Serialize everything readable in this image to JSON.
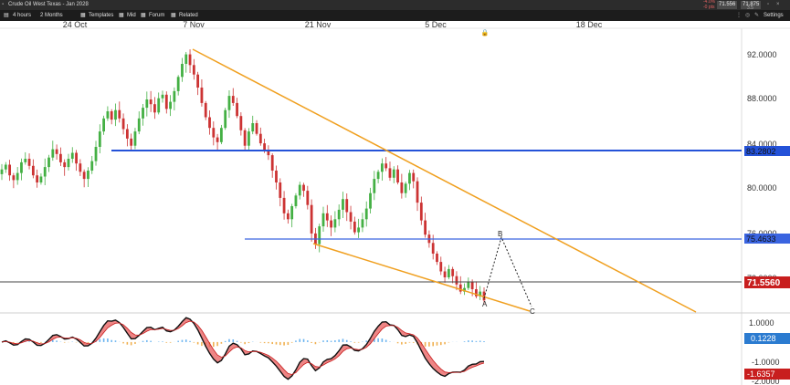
{
  "window": {
    "title": "Crude Oil West Texas - Jan 2023",
    "change_pct": "-4.0%",
    "change_pts": "-0 pts",
    "sell_price": "71.556",
    "buy_price": "71.875",
    "spread": "3.5"
  },
  "toolbar": {
    "interval": "4 hours",
    "range": "2 Months",
    "templates": "Templates",
    "price_type": "Mid",
    "forum": "Forum",
    "related": "Related",
    "settings": "Settings"
  },
  "chart_data": [
    {
      "type": "candlestick",
      "title": "",
      "x_ticks": [
        "24 Oct",
        "7 Nov",
        "21 Nov",
        "5 Dec",
        "18 Dec"
      ],
      "y_ticks": [
        "92.0000",
        "88.0000",
        "84.0000",
        "80.0000",
        "76.0000",
        "72.0000"
      ],
      "ylim": [
        70.5,
        94.5
      ],
      "grid": false,
      "close_series": [
        82.6,
        83.0,
        82.1,
        81.7,
        82.3,
        83.2,
        83.5,
        82.9,
        82.1,
        81.5,
        82.0,
        82.8,
        83.6,
        84.3,
        83.9,
        83.2,
        82.8,
        83.5,
        84.0,
        83.1,
        82.4,
        81.8,
        82.5,
        83.3,
        84.5,
        85.8,
        86.9,
        87.5,
        86.8,
        87.6,
        86.9,
        86.0,
        85.2,
        84.6,
        85.8,
        86.9,
        87.8,
        88.5,
        88.1,
        87.4,
        88.6,
        88.9,
        87.7,
        88.3,
        89.2,
        90.4,
        91.5,
        92.3,
        91.4,
        90.6,
        89.5,
        88.2,
        87.0,
        86.1,
        85.3,
        84.9,
        86.1,
        87.6,
        88.8,
        88.2,
        87.1,
        85.9,
        84.6,
        85.8,
        86.5,
        85.6,
        84.8,
        84.2,
        83.8,
        82.5,
        81.5,
        80.2,
        78.9,
        78.4,
        79.5,
        80.4,
        81.3,
        80.8,
        79.6,
        77.2,
        76.3,
        77.8,
        78.9,
        78.3,
        77.7,
        78.4,
        79.2,
        80.1,
        79.0,
        78.2,
        77.3,
        77.7,
        78.4,
        79.3,
        80.6,
        81.8,
        82.4,
        83.1,
        82.7,
        81.9,
        82.6,
        81.5,
        80.6,
        81.4,
        82.3,
        81.6,
        79.8,
        78.3,
        77.1,
        76.4,
        75.5,
        74.8,
        74.0,
        73.5,
        74.2,
        73.6,
        72.9,
        72.3,
        72.6,
        73.1,
        72.5,
        71.9,
        72.3,
        71.556
      ],
      "overlays": {
        "horizontal_levels": [
          {
            "label": "83.2802",
            "value": 83.28,
            "color": "#2452d8"
          },
          {
            "label": "75.4633",
            "value": 75.46,
            "color": "#3a64e0"
          },
          {
            "label": "71.5560",
            "value": 71.556,
            "color": "#444444"
          }
        ],
        "trendlines": [
          {
            "name": "upper",
            "from": [
              "7 Nov",
              92.4
            ],
            "to": [
              "after 18 Dec",
              70.0
            ],
            "color": "#f0a020"
          },
          {
            "name": "lower",
            "from": [
              "21 Nov",
              75.3
            ],
            "to": [
              "after 5 Dec",
              70.2
            ],
            "color": "#f0a020"
          }
        ],
        "projection": [
          {
            "label": "A",
            "value": 71.6
          },
          {
            "label": "B",
            "value": 75.6
          },
          {
            "label": "C",
            "value": 70.3
          }
        ]
      },
      "current_price_label": "71.5560",
      "current_price_color": "#c81e1e"
    },
    {
      "type": "macd",
      "y_ticks": [
        "1.0000",
        "-1.0000",
        "-2.0000"
      ],
      "ylim": [
        -2.1,
        1.3
      ],
      "current_values": [
        "0.1228",
        "-1.6357"
      ],
      "current_value_colors": [
        "#2b7bd0",
        "#c81e1e"
      ]
    }
  ]
}
